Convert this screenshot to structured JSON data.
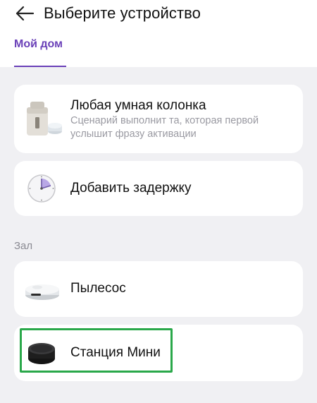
{
  "header": {
    "back_icon": "arrow-left-icon",
    "title": "Выберите устройство",
    "tab": "Мой дом",
    "accent_color": "#6a40b8"
  },
  "cards": [
    {
      "title": "Любая умная колонка",
      "description": "Сценарий выполнит та, которая первой услышит фразу активации",
      "icon": "smart-speakers-icon"
    },
    {
      "title": "Добавить задержку",
      "icon": "clock-icon"
    }
  ],
  "section": {
    "label": "Зал",
    "devices": [
      {
        "title": "Пылесос",
        "icon": "robot-vacuum-icon"
      },
      {
        "title": "Станция Мини",
        "icon": "station-mini-icon",
        "selected": true
      }
    ]
  },
  "selection_color": "#2aa84a"
}
